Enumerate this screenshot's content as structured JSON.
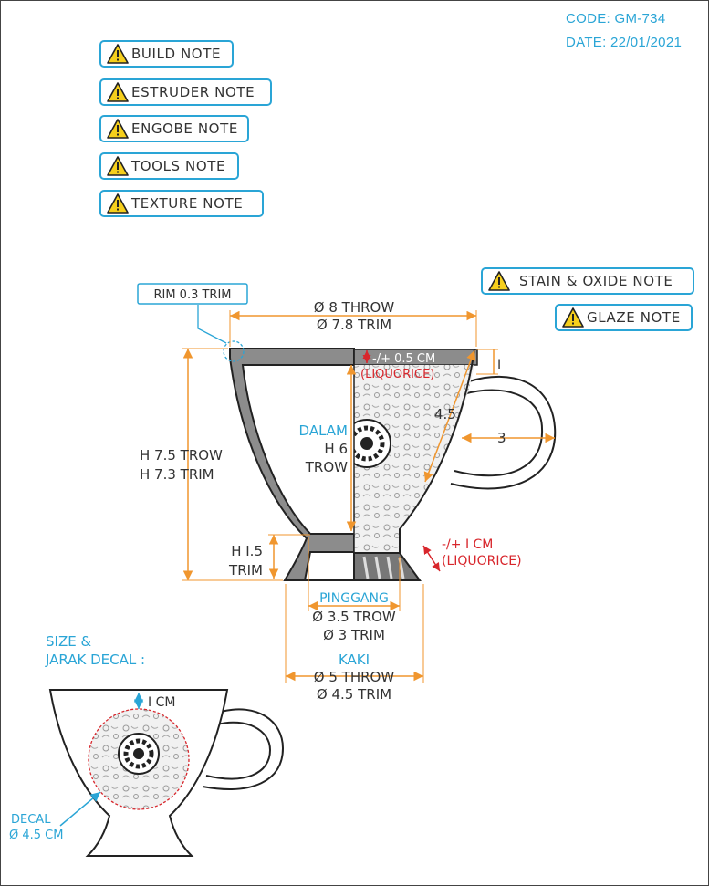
{
  "header": {
    "code": "CODE: GM-734",
    "date": "DATE: 22/01/2021"
  },
  "notes": [
    {
      "label": "BUILD NOTE",
      "icon": "warning-icon"
    },
    {
      "label": "ESTRUDER NOTE",
      "icon": "warning-icon"
    },
    {
      "label": "ENGOBE NOTE",
      "icon": "warning-icon"
    },
    {
      "label": "TOOLS NOTE",
      "icon": "warning-icon"
    },
    {
      "label": "TEXTURE NOTE",
      "icon": "warning-icon"
    },
    {
      "label": "STAIN & OXIDE NOTE",
      "icon": "warning-icon"
    },
    {
      "label": "GLAZE NOTE",
      "icon": "warning-icon"
    }
  ],
  "dimensions": {
    "rim_trim": "RIM 0.3 TRIM",
    "diameter_throw": "Ø 8 THROW",
    "diameter_trim": "Ø 7.8 TRIM",
    "rim_liquorice_value": "-/+ 0.5 CM",
    "rim_liquorice_label": "(LIQUORICE)",
    "handle_top": "I",
    "handle_length": "4.5",
    "handle_width": "3",
    "dalam_label": "DALAM",
    "dalam_h": "H 6",
    "dalam_throw": "TROW",
    "height_throw": "H 7.5 TROW",
    "height_trim": "H 7.3 TRIM",
    "foot_h": "H I.5",
    "foot_trim": "TRIM",
    "foot_liquorice_value": "-/+ I CM",
    "foot_liquorice_label": "(LIQUORICE)",
    "pinggang_label": "PINGGANG",
    "pinggang_throw": "Ø 3.5 TROW",
    "pinggang_trim": "Ø 3 TRIM",
    "kaki_label": "KAKI",
    "kaki_throw": "Ø 5 THROW",
    "kaki_trim": "Ø 4.5 TRIM"
  },
  "decal_section": {
    "title_line1": "SIZE &",
    "title_line2": "JARAK DECAL :",
    "gap": "I CM",
    "decal_label": "DECAL",
    "decal_size": "Ø 4.5 CM"
  },
  "colors": {
    "accent": "#2aa5d6",
    "dimension": "#f0962e",
    "liquorice": "#d8262c",
    "body_fill": "#8c8c8c",
    "outline": "#222222",
    "warning_yellow": "#f6cf1c"
  }
}
